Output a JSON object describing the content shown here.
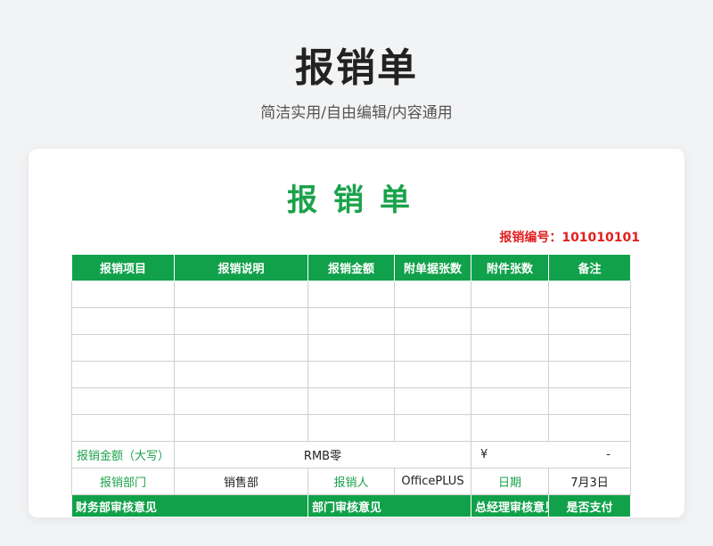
{
  "page": {
    "title": "报销单",
    "subtitle": "简洁实用/自由编辑/内容通用"
  },
  "document": {
    "title": "报销单",
    "number_label": "报销编号：",
    "number_value": "101010101",
    "columns": [
      "报销项目",
      "报销说明",
      "报销金额",
      "附单据张数",
      "附件张数",
      "备注"
    ],
    "empty_rows": 6,
    "amount_row": {
      "label": "报销金额（大写）",
      "rmb": "RMB零",
      "yen": "¥",
      "value": "-"
    },
    "dept_row": {
      "dept_label": "报销部门",
      "dept_value": "销售部",
      "person_label": "报销人",
      "person_value": "OfficePLUS",
      "date_label": "日期",
      "date_value": "7月3日"
    },
    "footer_headers": [
      "财务部审核意见",
      "部门审核意见",
      "总经理审核意见",
      "是否支付"
    ]
  },
  "colors": {
    "green": "#11a14a",
    "red": "#e02020"
  }
}
